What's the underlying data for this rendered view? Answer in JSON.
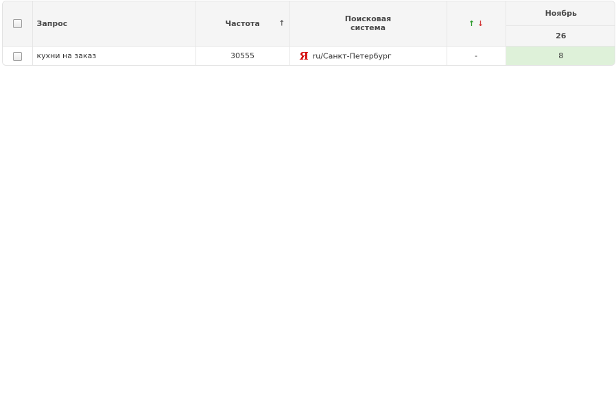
{
  "header": {
    "query_label": "Запрос",
    "frequency_label": "Частота",
    "sort_icon": "↑",
    "engine_line1": "Поисковая",
    "engine_line2": "система",
    "dynamics_up": "↑",
    "dynamics_down": "↓",
    "month_label": "Ноябрь",
    "day_label": "26"
  },
  "rows": [
    {
      "query": "кухни на заказ",
      "frequency": "30555",
      "engine_icon": "Я",
      "engine_region": "ru/Санкт-Петербург",
      "dynamics": "-",
      "position": "8"
    }
  ],
  "colors": {
    "position_highlight": "#def1d9",
    "arrow_up": "#2a9a2a",
    "arrow_down": "#d23a3a",
    "yandex_red": "#d20000"
  }
}
